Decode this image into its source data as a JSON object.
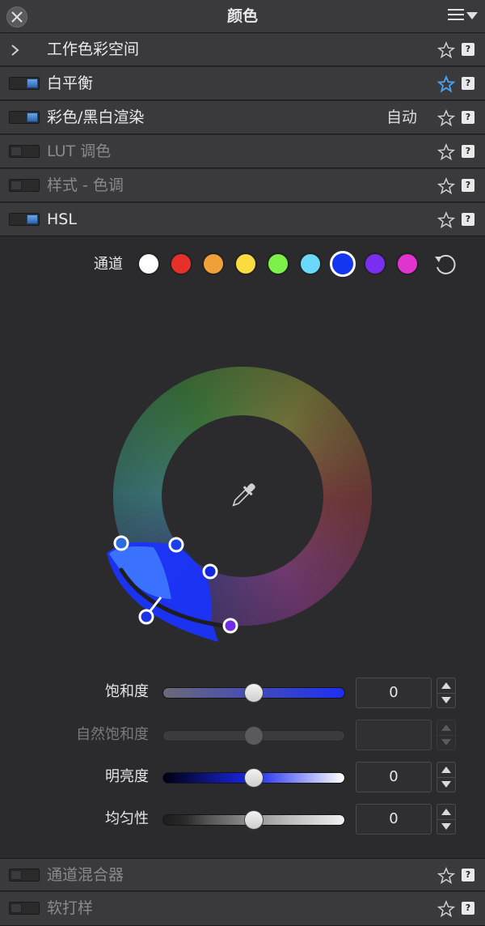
{
  "window": {
    "title": "颜色"
  },
  "sections": {
    "workspace": {
      "label": "工作色彩空间"
    },
    "white_balance": {
      "label": "白平衡"
    },
    "color_bw": {
      "label": "彩色/黑白渲染",
      "value": "自动"
    },
    "lut": {
      "label": "LUT 调色"
    },
    "style_tone": {
      "label": "样式 - 色调"
    },
    "hsl": {
      "label": "HSL"
    },
    "channel_mixer": {
      "label": "通道混合器"
    },
    "soft_proof": {
      "label": "软打样"
    }
  },
  "help_glyph": "?",
  "hsl": {
    "channel_label": "通道",
    "channels": [
      "#ffffff",
      "#e8302a",
      "#f0a038",
      "#f8dc40",
      "#7ef04a",
      "#6ad8f8",
      "#1436f0",
      "#7a2ef0",
      "#e034d0"
    ],
    "selected_channel": 6
  },
  "sliders": {
    "saturation": {
      "label": "饱和度",
      "value": "0"
    },
    "vibrance": {
      "label": "自然饱和度",
      "value": ""
    },
    "lightness": {
      "label": "明亮度",
      "value": "0"
    },
    "uniformity": {
      "label": "均匀性",
      "value": "0"
    }
  },
  "colors": {
    "accent_star": "#4aa3f0",
    "panel": "#3a3a3c",
    "background": "#2b2b2d"
  }
}
